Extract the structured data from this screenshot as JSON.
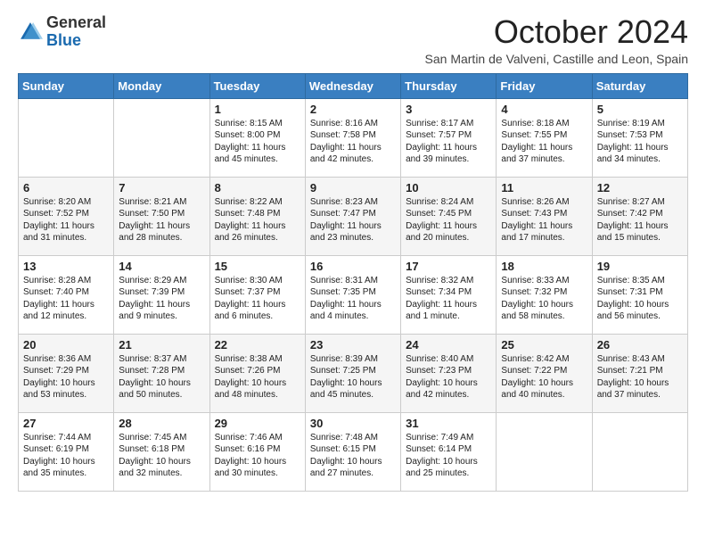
{
  "logo": {
    "general": "General",
    "blue": "Blue"
  },
  "title": "October 2024",
  "subtitle": "San Martin de Valveni, Castille and Leon, Spain",
  "days_of_week": [
    "Sunday",
    "Monday",
    "Tuesday",
    "Wednesday",
    "Thursday",
    "Friday",
    "Saturday"
  ],
  "weeks": [
    [
      {
        "day": "",
        "sunrise": "",
        "sunset": "",
        "daylight": ""
      },
      {
        "day": "",
        "sunrise": "",
        "sunset": "",
        "daylight": ""
      },
      {
        "day": "1",
        "sunrise": "Sunrise: 8:15 AM",
        "sunset": "Sunset: 8:00 PM",
        "daylight": "Daylight: 11 hours and 45 minutes."
      },
      {
        "day": "2",
        "sunrise": "Sunrise: 8:16 AM",
        "sunset": "Sunset: 7:58 PM",
        "daylight": "Daylight: 11 hours and 42 minutes."
      },
      {
        "day": "3",
        "sunrise": "Sunrise: 8:17 AM",
        "sunset": "Sunset: 7:57 PM",
        "daylight": "Daylight: 11 hours and 39 minutes."
      },
      {
        "day": "4",
        "sunrise": "Sunrise: 8:18 AM",
        "sunset": "Sunset: 7:55 PM",
        "daylight": "Daylight: 11 hours and 37 minutes."
      },
      {
        "day": "5",
        "sunrise": "Sunrise: 8:19 AM",
        "sunset": "Sunset: 7:53 PM",
        "daylight": "Daylight: 11 hours and 34 minutes."
      }
    ],
    [
      {
        "day": "6",
        "sunrise": "Sunrise: 8:20 AM",
        "sunset": "Sunset: 7:52 PM",
        "daylight": "Daylight: 11 hours and 31 minutes."
      },
      {
        "day": "7",
        "sunrise": "Sunrise: 8:21 AM",
        "sunset": "Sunset: 7:50 PM",
        "daylight": "Daylight: 11 hours and 28 minutes."
      },
      {
        "day": "8",
        "sunrise": "Sunrise: 8:22 AM",
        "sunset": "Sunset: 7:48 PM",
        "daylight": "Daylight: 11 hours and 26 minutes."
      },
      {
        "day": "9",
        "sunrise": "Sunrise: 8:23 AM",
        "sunset": "Sunset: 7:47 PM",
        "daylight": "Daylight: 11 hours and 23 minutes."
      },
      {
        "day": "10",
        "sunrise": "Sunrise: 8:24 AM",
        "sunset": "Sunset: 7:45 PM",
        "daylight": "Daylight: 11 hours and 20 minutes."
      },
      {
        "day": "11",
        "sunrise": "Sunrise: 8:26 AM",
        "sunset": "Sunset: 7:43 PM",
        "daylight": "Daylight: 11 hours and 17 minutes."
      },
      {
        "day": "12",
        "sunrise": "Sunrise: 8:27 AM",
        "sunset": "Sunset: 7:42 PM",
        "daylight": "Daylight: 11 hours and 15 minutes."
      }
    ],
    [
      {
        "day": "13",
        "sunrise": "Sunrise: 8:28 AM",
        "sunset": "Sunset: 7:40 PM",
        "daylight": "Daylight: 11 hours and 12 minutes."
      },
      {
        "day": "14",
        "sunrise": "Sunrise: 8:29 AM",
        "sunset": "Sunset: 7:39 PM",
        "daylight": "Daylight: 11 hours and 9 minutes."
      },
      {
        "day": "15",
        "sunrise": "Sunrise: 8:30 AM",
        "sunset": "Sunset: 7:37 PM",
        "daylight": "Daylight: 11 hours and 6 minutes."
      },
      {
        "day": "16",
        "sunrise": "Sunrise: 8:31 AM",
        "sunset": "Sunset: 7:35 PM",
        "daylight": "Daylight: 11 hours and 4 minutes."
      },
      {
        "day": "17",
        "sunrise": "Sunrise: 8:32 AM",
        "sunset": "Sunset: 7:34 PM",
        "daylight": "Daylight: 11 hours and 1 minute."
      },
      {
        "day": "18",
        "sunrise": "Sunrise: 8:33 AM",
        "sunset": "Sunset: 7:32 PM",
        "daylight": "Daylight: 10 hours and 58 minutes."
      },
      {
        "day": "19",
        "sunrise": "Sunrise: 8:35 AM",
        "sunset": "Sunset: 7:31 PM",
        "daylight": "Daylight: 10 hours and 56 minutes."
      }
    ],
    [
      {
        "day": "20",
        "sunrise": "Sunrise: 8:36 AM",
        "sunset": "Sunset: 7:29 PM",
        "daylight": "Daylight: 10 hours and 53 minutes."
      },
      {
        "day": "21",
        "sunrise": "Sunrise: 8:37 AM",
        "sunset": "Sunset: 7:28 PM",
        "daylight": "Daylight: 10 hours and 50 minutes."
      },
      {
        "day": "22",
        "sunrise": "Sunrise: 8:38 AM",
        "sunset": "Sunset: 7:26 PM",
        "daylight": "Daylight: 10 hours and 48 minutes."
      },
      {
        "day": "23",
        "sunrise": "Sunrise: 8:39 AM",
        "sunset": "Sunset: 7:25 PM",
        "daylight": "Daylight: 10 hours and 45 minutes."
      },
      {
        "day": "24",
        "sunrise": "Sunrise: 8:40 AM",
        "sunset": "Sunset: 7:23 PM",
        "daylight": "Daylight: 10 hours and 42 minutes."
      },
      {
        "day": "25",
        "sunrise": "Sunrise: 8:42 AM",
        "sunset": "Sunset: 7:22 PM",
        "daylight": "Daylight: 10 hours and 40 minutes."
      },
      {
        "day": "26",
        "sunrise": "Sunrise: 8:43 AM",
        "sunset": "Sunset: 7:21 PM",
        "daylight": "Daylight: 10 hours and 37 minutes."
      }
    ],
    [
      {
        "day": "27",
        "sunrise": "Sunrise: 7:44 AM",
        "sunset": "Sunset: 6:19 PM",
        "daylight": "Daylight: 10 hours and 35 minutes."
      },
      {
        "day": "28",
        "sunrise": "Sunrise: 7:45 AM",
        "sunset": "Sunset: 6:18 PM",
        "daylight": "Daylight: 10 hours and 32 minutes."
      },
      {
        "day": "29",
        "sunrise": "Sunrise: 7:46 AM",
        "sunset": "Sunset: 6:16 PM",
        "daylight": "Daylight: 10 hours and 30 minutes."
      },
      {
        "day": "30",
        "sunrise": "Sunrise: 7:48 AM",
        "sunset": "Sunset: 6:15 PM",
        "daylight": "Daylight: 10 hours and 27 minutes."
      },
      {
        "day": "31",
        "sunrise": "Sunrise: 7:49 AM",
        "sunset": "Sunset: 6:14 PM",
        "daylight": "Daylight: 10 hours and 25 minutes."
      },
      {
        "day": "",
        "sunrise": "",
        "sunset": "",
        "daylight": ""
      },
      {
        "day": "",
        "sunrise": "",
        "sunset": "",
        "daylight": ""
      }
    ]
  ]
}
